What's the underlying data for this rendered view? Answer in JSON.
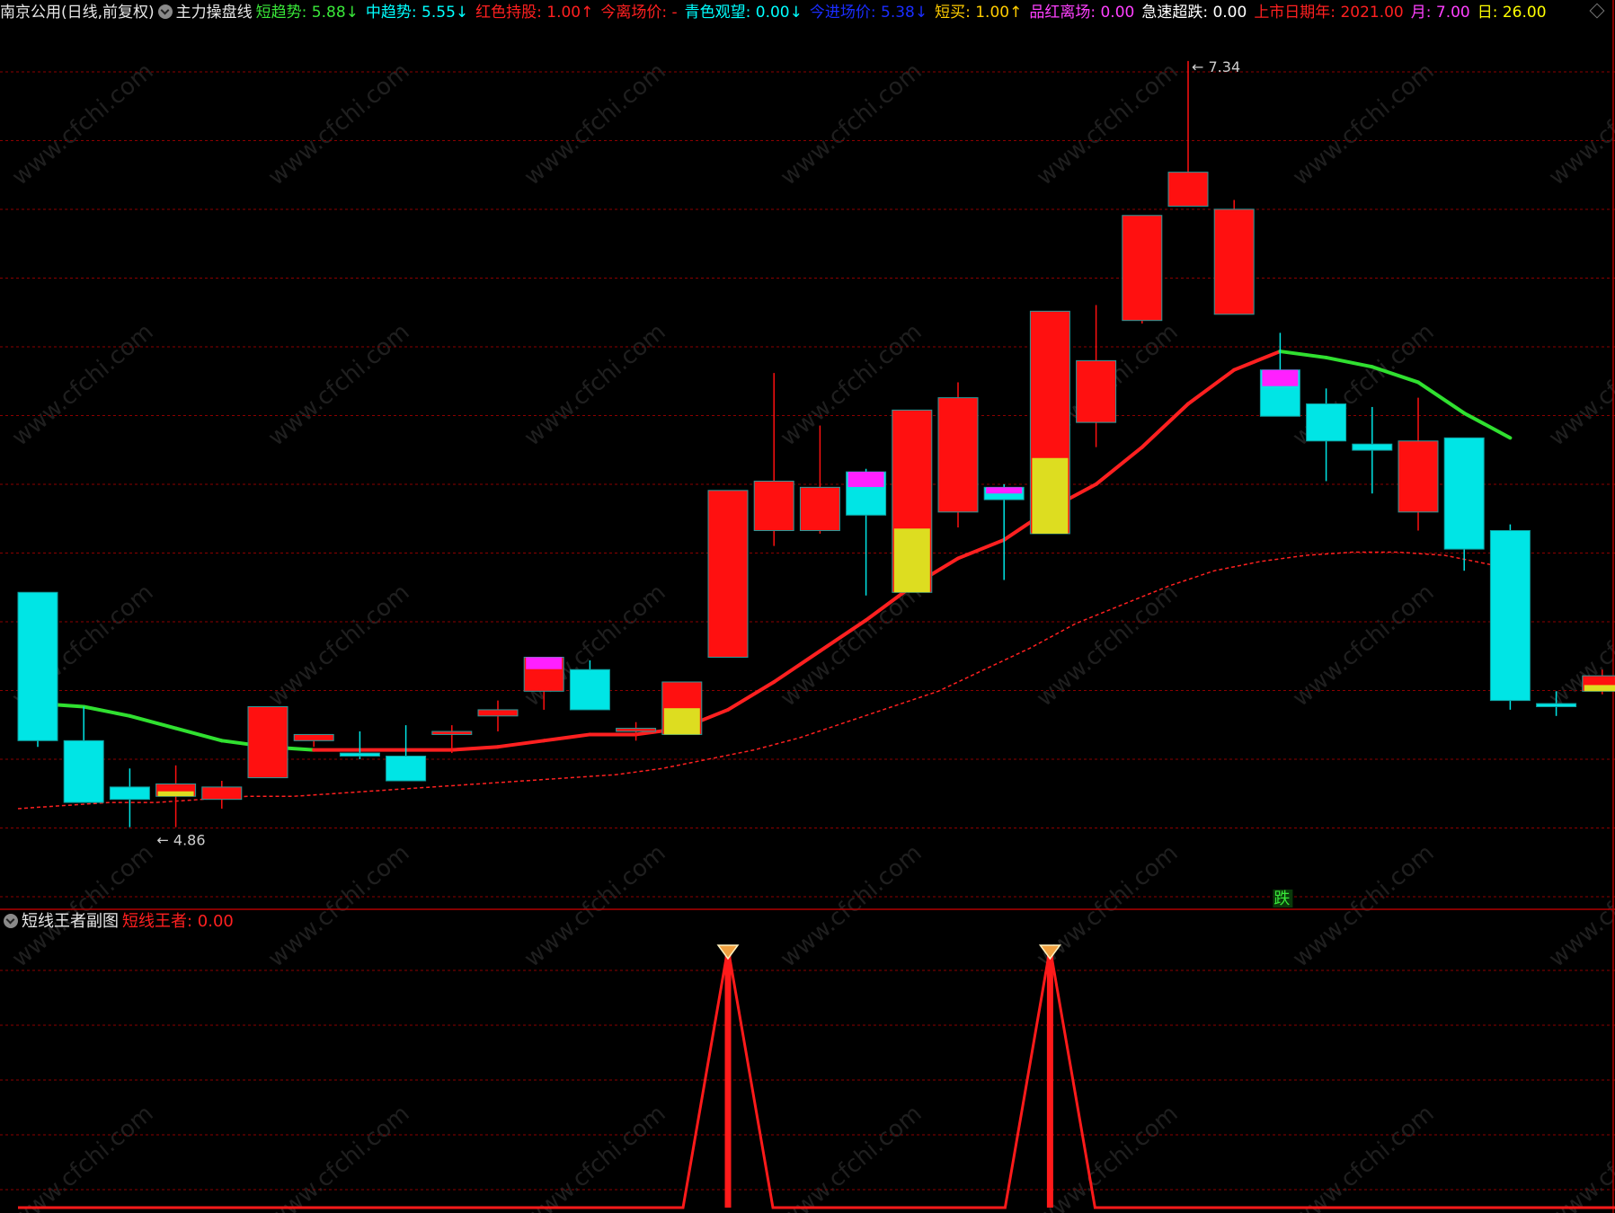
{
  "header": {
    "stock": "南京公用",
    "period": "(日线,前复权)",
    "indicator": "主力操盘线",
    "items": [
      {
        "label": "短趋势: ",
        "value": "5.88",
        "arrow": "↓",
        "color": "#39e639"
      },
      {
        "label": "中趋势: ",
        "value": "5.55",
        "arrow": "↓",
        "color": "#00ffff"
      },
      {
        "label": "红色持股: ",
        "value": "1.00",
        "arrow": "↑",
        "color": "#ff2020"
      },
      {
        "label": "今离场价: ",
        "value": "-",
        "arrow": "",
        "color": "#ff2020"
      },
      {
        "label": "青色观望: ",
        "value": "0.00",
        "arrow": "↓",
        "color": "#00ffff"
      },
      {
        "label": "今进场价: ",
        "value": "5.38",
        "arrow": "↓",
        "color": "#1a2dff"
      },
      {
        "label": "短买: ",
        "value": "1.00",
        "arrow": "↑",
        "color": "#ffcc00"
      },
      {
        "label": "品红离场: ",
        "value": "0.00",
        "arrow": "",
        "color": "#ff40ff"
      },
      {
        "label": "急速超跌: ",
        "value": "0.00",
        "arrow": "",
        "color": "#ffffff"
      },
      {
        "label": "上市日期年: ",
        "value": "2021.00",
        "arrow": "",
        "color": "#ff2020"
      },
      {
        "label": "月: ",
        "value": "7.00",
        "arrow": "",
        "color": "#ff40ff"
      },
      {
        "label": "日: ",
        "value": "26.00",
        "arrow": "",
        "color": "#ffff00"
      }
    ]
  },
  "sub_header": {
    "title": "短线王者副图",
    "label": "短线王者: ",
    "value": "0.00"
  },
  "annotations": {
    "high": "7.34",
    "low": "4.86",
    "signal": "跌"
  },
  "watermark": "www.cfchi.com",
  "colors": {
    "background": "#000000",
    "up": "#ff1010",
    "down": "#00e5e5",
    "magenta": "#ff20ff",
    "yellow": "#dddd20",
    "ma_short_up": "#ff2020",
    "ma_short_down": "#30e030",
    "ma_long": "#ff2020",
    "grid": "#8b0000"
  },
  "chart_data": {
    "type": "candlestick",
    "candles": [
      {
        "o": 5.62,
        "h": 5.62,
        "l": 5.12,
        "c": 5.14
      },
      {
        "o": 5.14,
        "h": 5.25,
        "l": 4.96,
        "c": 4.94
      },
      {
        "o": 4.99,
        "h": 5.05,
        "l": 4.86,
        "c": 4.95
      },
      {
        "o": 4.96,
        "h": 5.06,
        "l": 4.86,
        "c": 5.0
      },
      {
        "o": 4.95,
        "h": 5.01,
        "l": 4.92,
        "c": 4.99
      },
      {
        "o": 5.02,
        "h": 5.25,
        "l": 5.02,
        "c": 5.25
      },
      {
        "o": 5.14,
        "h": 5.16,
        "l": 5.12,
        "c": 5.16
      },
      {
        "o": 5.1,
        "h": 5.17,
        "l": 5.08,
        "c": 5.09
      },
      {
        "o": 5.09,
        "h": 5.19,
        "l": 5.04,
        "c": 5.01
      },
      {
        "o": 5.16,
        "h": 5.19,
        "l": 5.1,
        "c": 5.17
      },
      {
        "o": 5.22,
        "h": 5.27,
        "l": 5.17,
        "c": 5.24
      },
      {
        "o": 5.3,
        "h": 5.4,
        "l": 5.24,
        "c": 5.41
      },
      {
        "o": 5.37,
        "h": 5.4,
        "l": 5.24,
        "c": 5.24
      },
      {
        "o": 5.17,
        "h": 5.2,
        "l": 5.14,
        "c": 5.18
      },
      {
        "o": 5.16,
        "h": 5.33,
        "l": 5.16,
        "c": 5.33
      },
      {
        "o": 5.41,
        "h": 5.41,
        "l": 5.41,
        "c": 5.95
      },
      {
        "o": 5.82,
        "h": 6.33,
        "l": 5.77,
        "c": 5.98
      },
      {
        "o": 5.82,
        "h": 6.16,
        "l": 5.81,
        "c": 5.96
      },
      {
        "o": 6.01,
        "h": 6.02,
        "l": 5.61,
        "c": 5.87
      },
      {
        "o": 5.62,
        "h": 5.62,
        "l": 5.62,
        "c": 6.21
      },
      {
        "o": 5.88,
        "h": 6.3,
        "l": 5.83,
        "c": 6.25
      },
      {
        "o": 5.96,
        "h": 5.97,
        "l": 5.66,
        "c": 5.92
      },
      {
        "o": 5.81,
        "h": 5.81,
        "l": 5.81,
        "c": 6.53
      },
      {
        "o": 6.17,
        "h": 6.55,
        "l": 6.09,
        "c": 6.37
      },
      {
        "o": 6.5,
        "h": 6.5,
        "l": 6.49,
        "c": 6.84
      },
      {
        "o": 6.87,
        "h": 7.34,
        "l": 6.87,
        "c": 6.98
      },
      {
        "o": 6.52,
        "h": 6.89,
        "l": 6.52,
        "c": 6.86
      },
      {
        "o": 6.34,
        "h": 6.46,
        "l": 6.34,
        "c": 6.19
      },
      {
        "o": 6.23,
        "h": 6.28,
        "l": 5.98,
        "c": 6.11
      },
      {
        "o": 6.1,
        "h": 6.22,
        "l": 5.94,
        "c": 6.08
      },
      {
        "o": 5.88,
        "h": 6.25,
        "l": 5.82,
        "c": 6.11
      },
      {
        "o": 6.12,
        "h": 6.06,
        "l": 5.69,
        "c": 5.76
      },
      {
        "o": 5.82,
        "h": 5.84,
        "l": 5.24,
        "c": 5.27
      },
      {
        "o": 5.26,
        "h": 5.3,
        "l": 5.22,
        "c": 5.25
      },
      {
        "o": 5.3,
        "h": 5.37,
        "l": 5.29,
        "c": 5.35
      }
    ],
    "ma_short": [
      5.26,
      5.25,
      5.22,
      5.18,
      5.14,
      5.12,
      5.11,
      5.11,
      5.11,
      5.11,
      5.12,
      5.14,
      5.16,
      5.16,
      5.18,
      5.24,
      5.33,
      5.43,
      5.53,
      5.64,
      5.73,
      5.79,
      5.89,
      5.97,
      6.09,
      6.23,
      6.34,
      6.4,
      6.38,
      6.35,
      6.3,
      6.2,
      6.12
    ],
    "ma_long": [
      4.92,
      4.93,
      4.94,
      4.94,
      4.95,
      4.96,
      4.96,
      4.97,
      4.98,
      4.99,
      5.0,
      5.01,
      5.02,
      5.03,
      5.05,
      5.08,
      5.11,
      5.15,
      5.2,
      5.25,
      5.3,
      5.37,
      5.44,
      5.52,
      5.58,
      5.64,
      5.69,
      5.72,
      5.74,
      5.75,
      5.75,
      5.74,
      5.71
    ],
    "sub_signal": [
      0,
      0,
      0,
      0,
      0,
      0,
      0,
      0,
      0,
      0,
      0,
      0,
      0,
      0,
      0,
      1,
      0,
      0,
      0,
      0,
      0,
      0,
      1,
      0,
      0,
      0,
      0,
      0,
      0,
      0,
      0,
      0,
      0,
      0,
      0
    ],
    "ylim": [
      4.6,
      7.45
    ]
  }
}
